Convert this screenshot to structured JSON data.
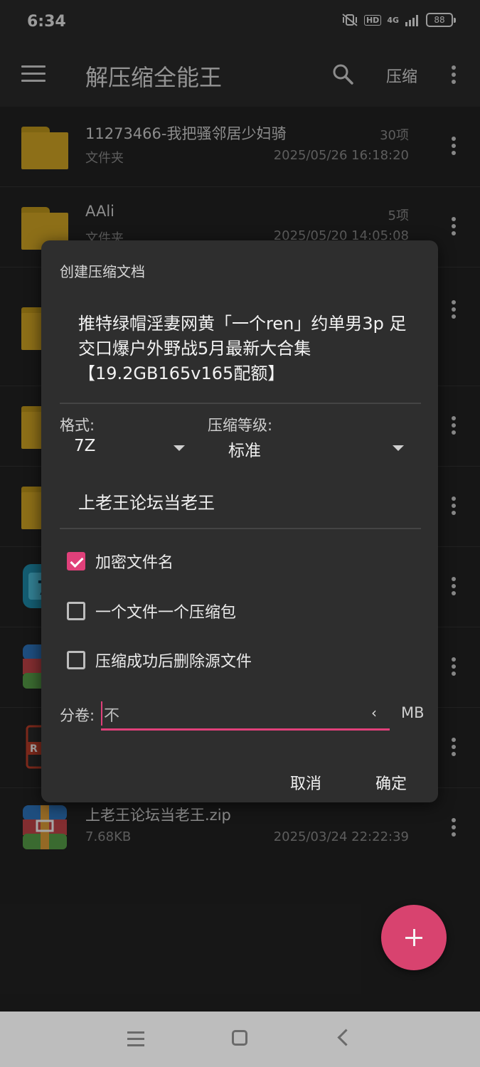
{
  "status_bar": {
    "time": "6:34",
    "network": "4G",
    "hd": "HD",
    "battery": "88"
  },
  "app_bar": {
    "title": "解压缩全能王",
    "compress_label": "压缩"
  },
  "files": [
    {
      "name": "11273466-我把骚邻居少妇骑",
      "subtitle": "文件夹",
      "count": "30项",
      "date": "2025/05/26 16:18:20",
      "icon": "folder"
    },
    {
      "name": "AAli",
      "subtitle": "文件夹",
      "count": "5项",
      "date": "2025/05/20 14:05:08",
      "icon": "folder"
    },
    {
      "name": "",
      "subtitle": "",
      "count": "",
      "date": "",
      "icon": "folder"
    },
    {
      "name": "",
      "subtitle": "",
      "count": "",
      "date": "",
      "icon": "folder"
    },
    {
      "name": "",
      "subtitle": "",
      "count": "",
      "date": "",
      "icon": "folder"
    },
    {
      "name": "",
      "subtitle": "",
      "count": "",
      "date": "",
      "icon": "7z-archive"
    },
    {
      "name": "",
      "subtitle": "",
      "count": "",
      "date": "",
      "icon": "zip-archive"
    },
    {
      "name": "",
      "subtitle": "",
      "count": "",
      "date": "",
      "icon": "rar-archive"
    },
    {
      "name": "上老王论坛当老王.zip",
      "subtitle": "7.68KB",
      "count": "",
      "date": "2025/03/24 22:22:39",
      "icon": "zip-archive"
    }
  ],
  "dialog": {
    "title": "创建压缩文档",
    "archive_name": "推特绿帽淫妻网黄「一个ren」约单男3p 足交口爆户外野战5月最新大合集【19.2GB165v165配额】",
    "format_label": "格式:",
    "format_value": "7Z",
    "level_label": "压缩等级:",
    "level_value": "标准",
    "password": "上老王论坛当老王",
    "options": [
      {
        "label": "加密文件名",
        "checked": true
      },
      {
        "label": "一个文件一个压缩包",
        "checked": false
      },
      {
        "label": "压缩成功后删除源文件",
        "checked": false
      }
    ],
    "volume_label": "分卷:",
    "volume_value": "不",
    "volume_caret": "‹",
    "volume_unit": "MB",
    "cancel_label": "取消",
    "confirm_label": "确定"
  },
  "fab_icon": "plus-icon",
  "colors": {
    "accent": "#e0407a",
    "folder": "#d9ab26",
    "background": "#232323",
    "dialog": "#2e2e2e"
  }
}
